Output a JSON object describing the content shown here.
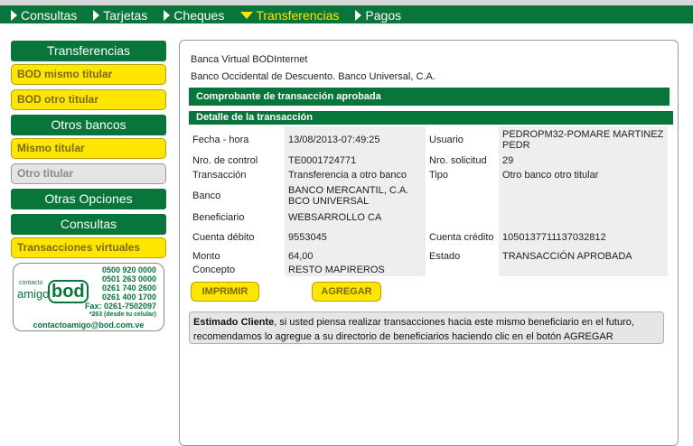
{
  "nav": {
    "items": [
      {
        "label": "Consultas"
      },
      {
        "label": "Tarjetas"
      },
      {
        "label": "Cheques"
      },
      {
        "label": "Transferencias"
      },
      {
        "label": "Pagos"
      }
    ],
    "accent": "#ffe600",
    "brand": "#08753a"
  },
  "sidebar": {
    "sec_transferencias": "Transferencias",
    "bod_mismo": "BOD mismo titular",
    "bod_otro": "BOD otro titular",
    "sec_otros_bancos": "Otros bancos",
    "mismo_titular": "Mismo titular",
    "otro_titular": "Otro titular",
    "sec_otras_opciones": "Otras Opciones",
    "sec_consultas": "Consultas",
    "transacciones_virtuales": "Transacciones virtuales",
    "contact": {
      "logo_small": "contacto",
      "logo_word": "amigo",
      "logo_brand": "bod",
      "phone1": "0500 920 0000",
      "phone2": "0501 263 0000",
      "phone3": "0261 740 2600",
      "phone4": "0261 400 1700",
      "fax": "Fax: 0261-7502097",
      "cel": "*263 (desde tu celular)",
      "email": "contactoamigo@bod.com.ve"
    }
  },
  "main": {
    "bank_line1": "Banca Virtual BODInternet",
    "bank_line2": "Banco Occidental de Descuento. Banco Universal, C.A.",
    "bar_title": "Comprobante de transacción aprobada",
    "bar_detail": "Detalle de la transacción",
    "rows": [
      {
        "l1": "Fecha - hora",
        "v1": "13/08/2013-07:49:25",
        "l2": "Usuario",
        "v2": "PEDROPM32-POMARE MARTINEZ PEDR"
      },
      {
        "l1": "Nro. de control",
        "v1": "TE0001724771",
        "l2": "Nro. solicitud",
        "v2": "29"
      },
      {
        "l1": "Transacción",
        "v1": "Transferencia a otro banco",
        "l2": "Tipo",
        "v2": "Otro banco otro titular"
      },
      {
        "l1": "Banco",
        "v1": "BANCO MERCANTIL, C.A. BCO UNIVERSAL",
        "l2": "",
        "v2": ""
      },
      {
        "l1": "Beneficiario",
        "v1": "WEBSARROLLO CA",
        "l2": "",
        "v2": ""
      },
      {
        "l1": "Cuenta débito",
        "v1": "9553045",
        "l2": "Cuenta crédito",
        "v2": "10501377111370328​12"
      },
      {
        "l1": "Monto",
        "v1": "64,00",
        "l2": "Estado",
        "v2": "TRANSACCIÓN APROBADA"
      },
      {
        "l1": "Concepto",
        "v1": "RESTO MAPIREROS",
        "l2": "",
        "v2": ""
      }
    ],
    "btn_print": "IMPRIMIR",
    "btn_add": "AGREGAR",
    "note_bold": "Estimado Cliente",
    "note_text": ", si usted piensa realizar transacciones hacia este mismo beneficiario en el futuro, recomendamos lo agregue a su directorio de beneficiarios haciendo clic en el botón AGREGAR"
  }
}
